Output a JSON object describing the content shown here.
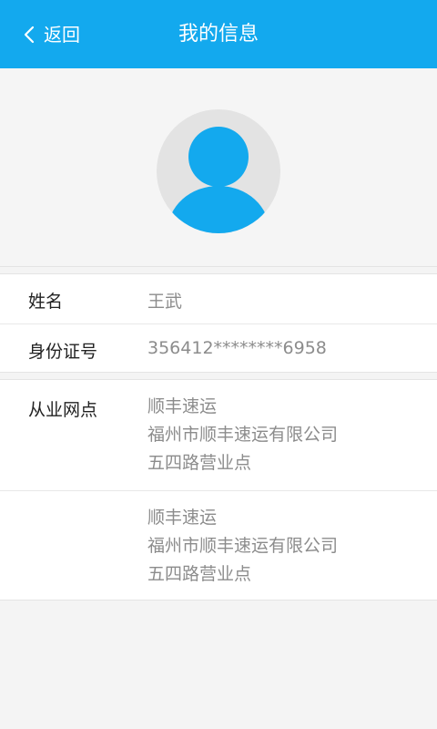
{
  "header": {
    "back_label": "返回",
    "title": "我的信息",
    "background_color": "#13a9ee"
  },
  "avatar": {
    "icon": "user-avatar-icon",
    "color": "#13a9ee"
  },
  "profile": {
    "name_label": "姓名",
    "name_value": "王武",
    "id_label": "身份证号",
    "id_value": "356412********6958"
  },
  "branches": {
    "label": "从业网点",
    "items": [
      {
        "line1": "顺丰速运",
        "line2": "福州市顺丰速运有限公司",
        "line3": "五四路营业点"
      },
      {
        "line1": "顺丰速运",
        "line2": "福州市顺丰速运有限公司",
        "line3": "五四路营业点"
      }
    ]
  }
}
